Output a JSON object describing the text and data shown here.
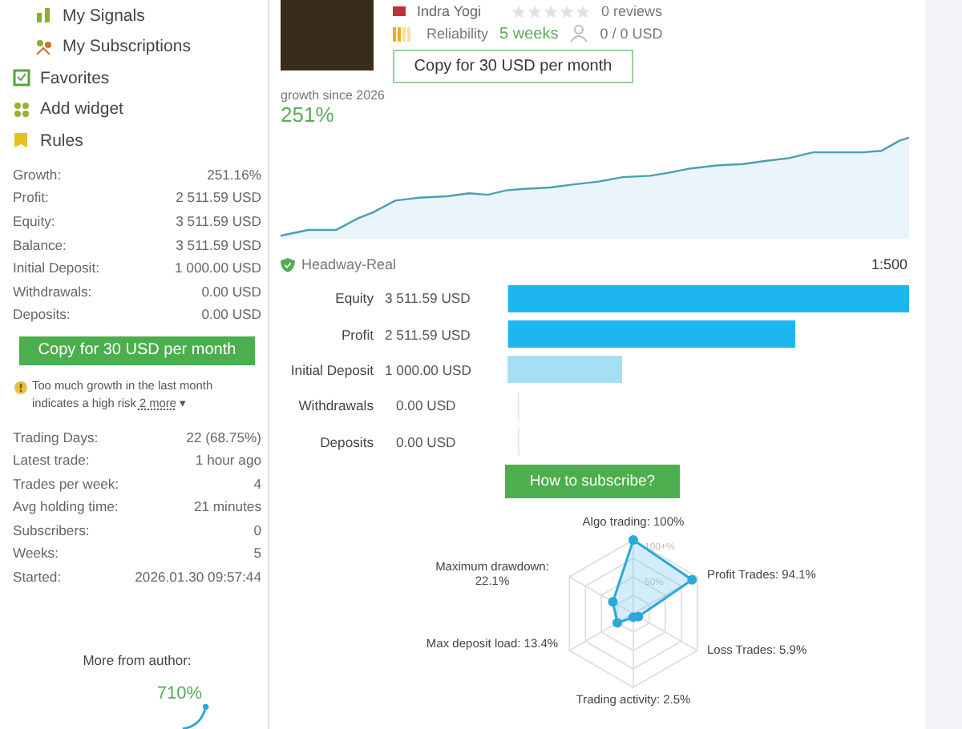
{
  "sidebar": {
    "nav": [
      {
        "label": "My Signals",
        "kind": "signals",
        "sub": true
      },
      {
        "label": "My Subscriptions",
        "kind": "subscriptions",
        "sub": true
      },
      {
        "label": "Favorites",
        "kind": "favorites",
        "sub": false
      },
      {
        "label": "Add widget",
        "kind": "widget",
        "sub": false
      },
      {
        "label": "Rules",
        "kind": "rules",
        "sub": false
      }
    ],
    "stats": [
      {
        "label": "Growth:",
        "value": "251.16%"
      },
      {
        "label": "Profit:",
        "value": "2 511.59 USD"
      },
      {
        "label": "Equity:",
        "value": "3 511.59 USD"
      },
      {
        "label": "Balance:",
        "value": "3 511.59 USD"
      },
      {
        "label": "Initial Deposit:",
        "value": "1 000.00 USD"
      },
      {
        "label": "Withdrawals:",
        "value": "0.00 USD"
      },
      {
        "label": "Deposits:",
        "value": "0.00 USD"
      }
    ],
    "copy_button": "Copy for 30 USD per month",
    "warning": {
      "text": "Too much growth in the last month indicates a high risk",
      "link": "2 more",
      "caret": "▾"
    },
    "stats_2": [
      {
        "label": "Trading Days:",
        "value": "22 (68.75%)"
      },
      {
        "label": "Latest trade:",
        "value": "1 hour ago"
      },
      {
        "label": "Trades per week:",
        "value": "4"
      },
      {
        "label": "Avg holding time:",
        "value": "21 minutes"
      },
      {
        "label": "Subscribers:",
        "value": "0"
      },
      {
        "label": "Weeks:",
        "value": "5"
      },
      {
        "label": "Started:",
        "value": "2026.01.30 09:57:44"
      }
    ],
    "more_from_author": {
      "title": "More from author:",
      "growth": "710%"
    }
  },
  "signal": {
    "author": "Indra Yogi",
    "stars": 0,
    "reviews": "0 reviews",
    "reliability": "Reliability",
    "weeks": "5 weeks",
    "subscribers_funds": "0 / 0 USD",
    "copy_button": "Copy for 30 USD per month",
    "growth_label": "growth since 2026",
    "growth": "251%"
  },
  "account": {
    "broker": "Headway-Real",
    "leverage": "1:500",
    "rows": [
      {
        "label": "Equity",
        "value": "3 511.59 USD",
        "level": 1,
        "color": "#1eb6ee"
      },
      {
        "label": "Profit",
        "value": "2 511.59 USD",
        "level": 0.715,
        "color": "#1eb6ee"
      },
      {
        "label": "Initial Deposit",
        "value": "1 000.00 USD",
        "level": 0.285,
        "color": "#a6def6"
      },
      {
        "label": "Withdrawals",
        "value": "0.00 USD"
      },
      {
        "label": "Deposits",
        "value": "0.00 USD"
      }
    ],
    "subscribe_button": "How to subscribe?"
  },
  "radar": {
    "ticks": [
      "100+%",
      "50%"
    ],
    "axes": [
      {
        "label": "Algo trading: 100%"
      },
      {
        "label": "Maximum drawdown: 22.1%"
      },
      {
        "label": "Profit Trades: 94.1%"
      },
      {
        "label": "Max deposit load: 13.4%"
      },
      {
        "label": "Loss Trades: 5.9%"
      },
      {
        "label": "Trading activity: 2.5%"
      }
    ]
  }
}
